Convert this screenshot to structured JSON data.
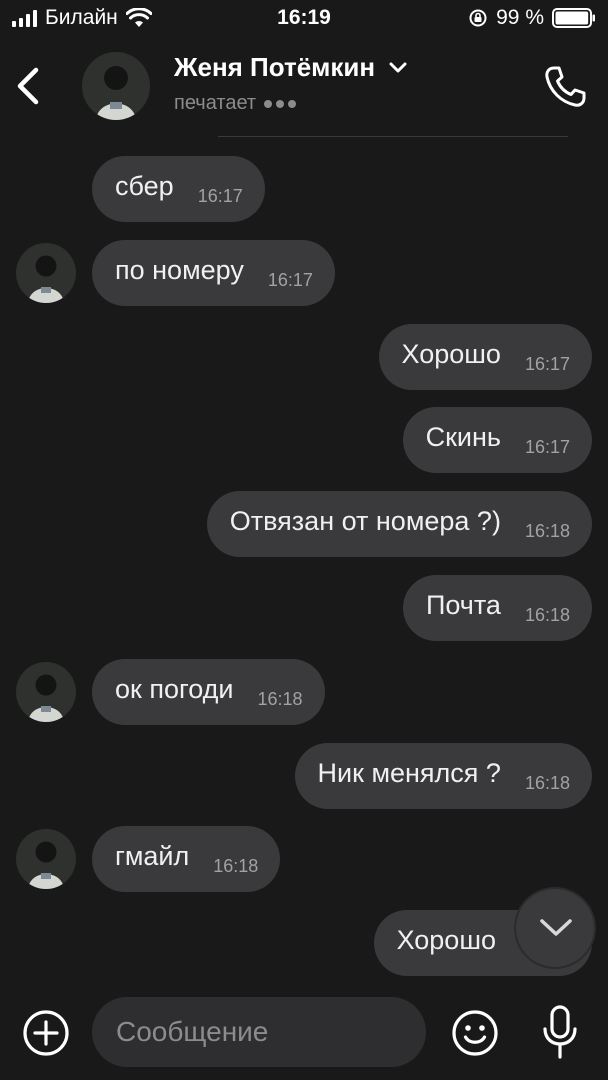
{
  "status_bar": {
    "carrier": "Билайн",
    "time": "16:19",
    "battery_percent": "99 %",
    "battery_level": 0.99
  },
  "header": {
    "contact_name": "Женя Потёмкин",
    "status": "печатает"
  },
  "messages": [
    {
      "direction": "incoming",
      "text": "сбер",
      "time": "16:17",
      "avatar": false
    },
    {
      "direction": "incoming",
      "text": "по номеру",
      "time": "16:17",
      "avatar": true
    },
    {
      "direction": "outgoing",
      "text": "Хорошо",
      "time": "16:17"
    },
    {
      "direction": "outgoing",
      "text": "Скинь",
      "time": "16:17"
    },
    {
      "direction": "outgoing",
      "text": "Отвязан от номера ?)",
      "time": "16:18"
    },
    {
      "direction": "outgoing",
      "text": "Почта",
      "time": "16:18"
    },
    {
      "direction": "incoming",
      "text": "ок погоди",
      "time": "16:18",
      "avatar": true
    },
    {
      "direction": "outgoing",
      "text": "Ник менялся ?",
      "time": "16:18"
    },
    {
      "direction": "incoming",
      "text": "гмайл",
      "time": "16:18",
      "avatar": true
    },
    {
      "direction": "outgoing",
      "text": "Хорошо",
      "time": ""
    }
  ],
  "composer": {
    "placeholder": "Сообщение"
  },
  "icons": {
    "back": "chevron-left-icon",
    "call": "phone-icon",
    "expand": "chevron-down-icon",
    "scroll_down": "chevron-down-icon",
    "add": "plus-circle-icon",
    "emoji": "smiley-icon",
    "mic": "microphone-icon"
  },
  "colors": {
    "background": "#19191a",
    "bubble": "#3a3a3c",
    "input": "#2e2e30",
    "text": "#f0f0f2",
    "muted": "#8c8c8f"
  }
}
